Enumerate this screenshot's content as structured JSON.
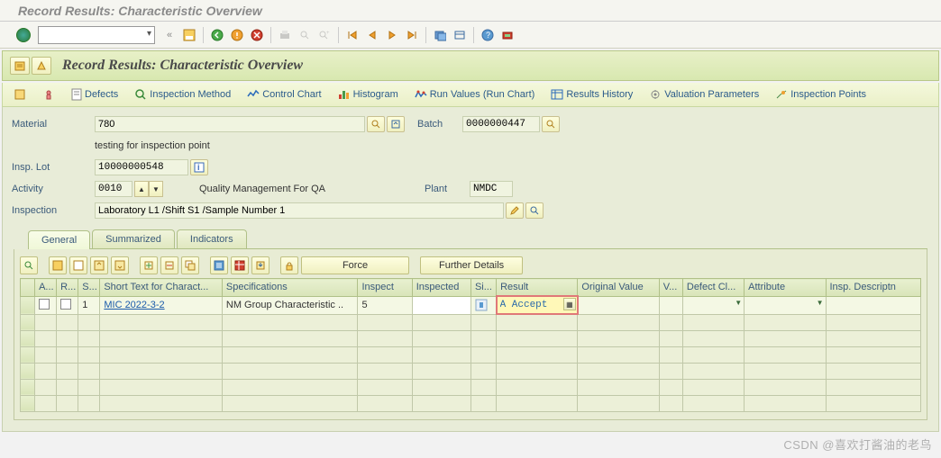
{
  "window": {
    "title": "Record Results: Characteristic Overview"
  },
  "header": {
    "title": "Record Results: Characteristic Overview"
  },
  "toolbar2": {
    "defects": "Defects",
    "insp_method": "Inspection Method",
    "control_chart": "Control Chart",
    "histogram": "Histogram",
    "run_values": "Run Values (Run Chart)",
    "results_history": "Results History",
    "valuation_params": "Valuation Parameters",
    "inspection_points": "Inspection Points"
  },
  "form": {
    "material_label": "Material",
    "material_value": "780",
    "material_desc": "testing for inspection point",
    "batch_label": "Batch",
    "batch_value": "0000000447",
    "insp_lot_label": "Insp. Lot",
    "insp_lot_value": "10000000548",
    "activity_label": "Activity",
    "activity_value": "0010",
    "activity_desc": "Quality Management For QA",
    "plant_label": "Plant",
    "plant_value": "NMDC",
    "inspection_label": "Inspection",
    "inspection_value": "Laboratory L1 /Shift S1 /Sample Number 1"
  },
  "tabs": {
    "general": "General",
    "summarized": "Summarized",
    "indicators": "Indicators"
  },
  "grid_toolbar": {
    "force": "Force",
    "further_details": "Further Details"
  },
  "grid": {
    "cols": {
      "a": "A...",
      "r": "R...",
      "s": "S...",
      "short_text": "Short Text for Charact...",
      "spec": "Specifications",
      "inspect": "Inspect",
      "inspected": "Inspected",
      "si": "Si...",
      "result": "Result",
      "orig_val": "Original Value",
      "v": "V...",
      "defect": "Defect Cl...",
      "attribute": "Attribute",
      "insp_desc": "Insp. Descriptn"
    },
    "row1": {
      "s": "1",
      "short_text": "MIC 2022-3-2",
      "spec": "NM Group Characteristic ..",
      "inspect": "5",
      "result": "A Accept"
    }
  },
  "watermark": "CSDN @喜欢打酱油的老鸟"
}
